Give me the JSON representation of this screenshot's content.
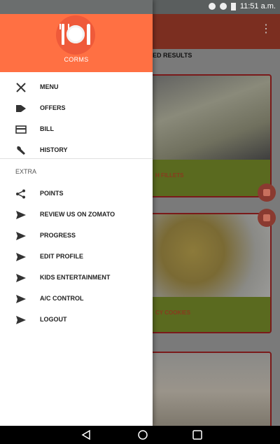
{
  "status_bar": {
    "time": "11:51 a.m."
  },
  "drawer": {
    "brand": "CORMS",
    "items": [
      {
        "label": "MENU",
        "icon": "fork-knife-icon"
      },
      {
        "label": "OFFERS",
        "icon": "tag-icon"
      },
      {
        "label": "BILL",
        "icon": "card-icon"
      },
      {
        "label": "HISTORY",
        "icon": "wrench-icon"
      }
    ],
    "section_label": "EXTRA",
    "extra_items": [
      {
        "label": "POINTS",
        "icon": "share-icon"
      },
      {
        "label": "REVIEW US ON ZOMATO",
        "icon": "send-icon"
      },
      {
        "label": "PROGRESS",
        "icon": "send-icon"
      },
      {
        "label": "EDIT PROFILE",
        "icon": "send-icon"
      },
      {
        "label": "KIDS ENTERTAINMENT",
        "icon": "send-icon"
      },
      {
        "label": "A/C CONTROL",
        "icon": "send-icon"
      },
      {
        "label": "LOGOUT",
        "icon": "send-icon"
      }
    ]
  },
  "background": {
    "results_label": "ED RESULTS",
    "cards": [
      {
        "caption": "H FILLETS"
      },
      {
        "caption": "CY COOKIES"
      },
      {
        "caption": ""
      }
    ]
  },
  "colors": {
    "header": "#ff7043",
    "logo_circle": "#ef5a3a",
    "navbar": "#000000"
  }
}
